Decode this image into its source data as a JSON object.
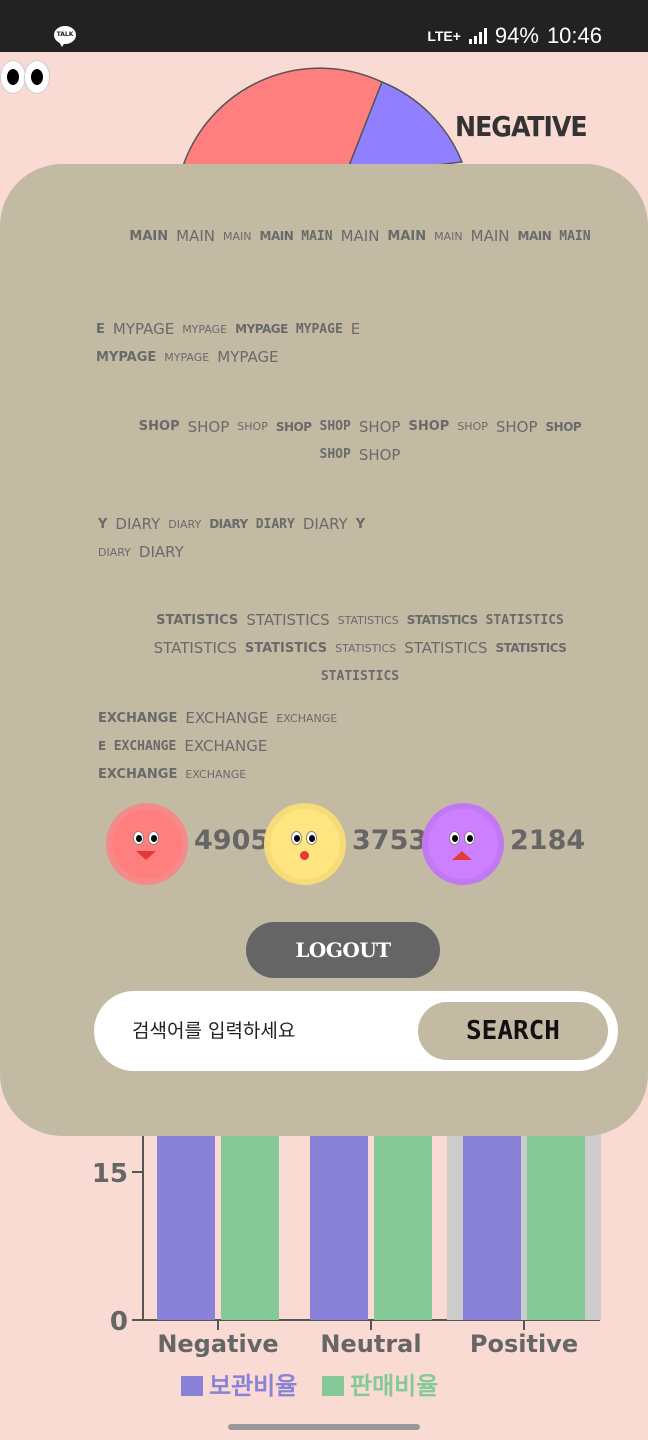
{
  "status_bar": {
    "talk_icon_label": "TALK",
    "network": "LTE+",
    "battery": "94%",
    "time": "10:46"
  },
  "pie": {
    "title": "NEGATIVE",
    "colors": {
      "negative": "#ff7f7f",
      "other": "#9080ff"
    }
  },
  "menu": {
    "rows": [
      {
        "name": "main",
        "words": [
          "MAIN",
          "MAIN",
          "MAIN",
          "MAIN",
          "MAIN",
          "MAIN",
          "MAIN",
          "MAIN",
          "MAIN",
          "MAIN",
          "MAIN"
        ]
      },
      {
        "name": "mypage",
        "words": [
          "E",
          "MYPAGE",
          "MYPAGE",
          "MYPAGE",
          "MYPAGE",
          "E",
          "MYPAGE",
          "MYPAGE",
          "MYPAGE"
        ]
      },
      {
        "name": "shop",
        "words": [
          "SHOP",
          "SHOP",
          "SHOP",
          "SHOP",
          "SHOP",
          "SHOP",
          "SHOP",
          "SHOP",
          "SHOP",
          "SHOP",
          "SHOP",
          "SHOP"
        ]
      },
      {
        "name": "diary",
        "words": [
          "Y",
          "DIARY",
          "DIARY",
          "DIARY",
          "DIARY",
          "DIARY",
          "Y",
          "DIARY",
          "DIARY"
        ]
      },
      {
        "name": "statistics",
        "words": [
          "STATISTICS",
          "STATISTICS",
          "STATISTICS",
          "STATISTICS",
          "STATISTICS",
          "STATISTICS",
          "STATISTICS",
          "STATISTICS",
          "STATISTICS",
          "STATISTICS",
          "STATISTICS"
        ]
      },
      {
        "name": "exchange",
        "words": [
          "EXCHANGE",
          "EXCHANGE",
          "EXCHANGE",
          "E",
          "EXCHANGE",
          "EXCHANGE",
          "EXCHANGE",
          "EXCHANGE"
        ]
      }
    ],
    "counts": [
      {
        "label": "negative",
        "value": "4905",
        "color": "#ff7f7f"
      },
      {
        "label": "neutral",
        "value": "3753",
        "color": "#ffe57f"
      },
      {
        "label": "positive",
        "value": "2184",
        "color": "#cc80ff"
      }
    ],
    "logout_label": "LOGOUT",
    "search": {
      "placeholder": "검색어를 입력하세요",
      "button_label": "SEARCH"
    }
  },
  "chart_data": {
    "type": "bar",
    "categories": [
      "Negative",
      "Neutral",
      "Positive"
    ],
    "series": [
      {
        "name": "보관비율",
        "color": "#8a82d8"
      },
      {
        "name": "판매비율",
        "color": "#86c998"
      }
    ],
    "yticks": [
      "0",
      "15"
    ],
    "legend_position": "bottom"
  }
}
